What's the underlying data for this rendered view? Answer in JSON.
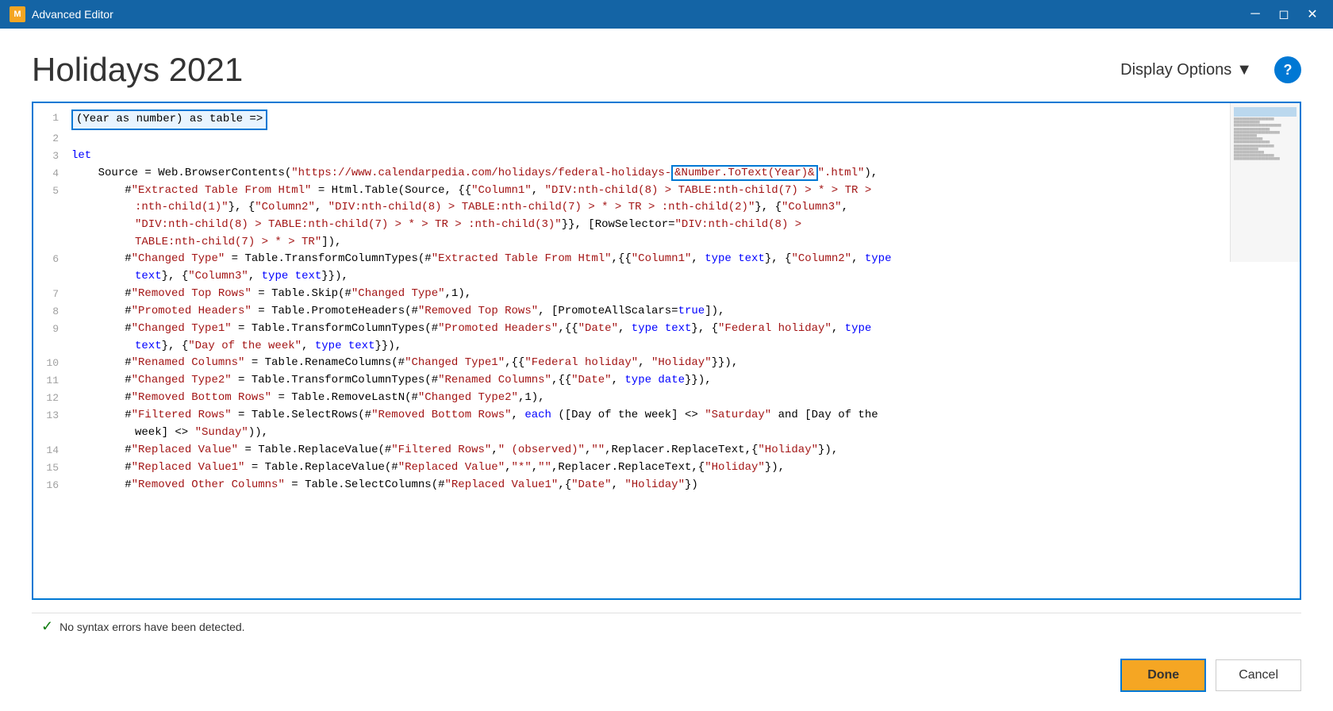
{
  "window": {
    "title": "Advanced Editor"
  },
  "page": {
    "title": "Holidays 2021",
    "display_options_label": "Display Options",
    "help_label": "?"
  },
  "status": {
    "message": "No syntax errors have been detected."
  },
  "buttons": {
    "done": "Done",
    "cancel": "Cancel"
  },
  "code": {
    "line1": "(Year as number) as table =>",
    "line3": "let",
    "line4_pre": "    Source = Web.BrowserContents(\"https://www.calendarpedia.com/holidays/federal-holidays-",
    "line4_highlight": "&Number.ToText(Year)&",
    "line4_post": "\".html\"),",
    "line5": "        #\"Extracted Table From Html\" = Html.Table(Source, {{\"Column1\", \"DIV:nth-child(8) > TABLE:nth-child(7) > * > TR >\n            :nth-child(1)\"}, {\"Column2\", \"DIV:nth-child(8) > TABLE:nth-child(7) > * > TR > :nth-child(2)\"}, {\"Column3\",\n            \"DIV:nth-child(8) > TABLE:nth-child(7) > * > TR > :nth-child(3)\"}}, [RowSelector=\"DIV:nth-child(8) >\n            TABLE:nth-child(7) > * > TR\"]),",
    "line6": "        #\"Changed Type\" = Table.TransformColumnTypes(#\"Extracted Table From Html\",{{\"Column1\", type text}, {\"Column2\", type\n            text}, {\"Column3\", type text}}),",
    "line7": "        #\"Removed Top Rows\" = Table.Skip(#\"Changed Type\",1),",
    "line8": "        #\"Promoted Headers\" = Table.PromoteHeaders(#\"Removed Top Rows\", [PromoteAllScalars=true]),",
    "line9": "        #\"Changed Type1\" = Table.TransformColumnTypes(#\"Promoted Headers\",{{\"Date\", type text}, {\"Federal holiday\", type\n            text}, {\"Day of the week\", type text}}),",
    "line10": "        #\"Renamed Columns\" = Table.RenameColumns(#\"Changed Type1\",{{\"Federal holiday\", \"Holiday\"}}),",
    "line11": "        #\"Changed Type2\" = Table.TransformColumnTypes(#\"Renamed Columns\",{{\"Date\", type date}}),",
    "line12": "        #\"Removed Bottom Rows\" = Table.RemoveLastN(#\"Changed Type2\",1),",
    "line13": "        #\"Filtered Rows\" = Table.SelectRows(#\"Removed Bottom Rows\", each ([Day of the week] <> \"Saturday\" and [Day of the\n            week] <> \"Sunday\")),",
    "line14": "        #\"Replaced Value\" = Table.ReplaceValue(#\"Filtered Rows\",\" (observed)\",\"\",Replacer.ReplaceText,{\"Holiday\"}),",
    "line15": "        #\"Replaced Value1\" = Table.ReplaceValue(#\"Replaced Value\",\"*\",\"\",Replacer.ReplaceText,{\"Holiday\"}),",
    "line16": "        #\"Removed Other Columns\" = Table.SelectColumns(#\"Replaced Value1\",{\"Date\", \"Holiday\"})"
  }
}
